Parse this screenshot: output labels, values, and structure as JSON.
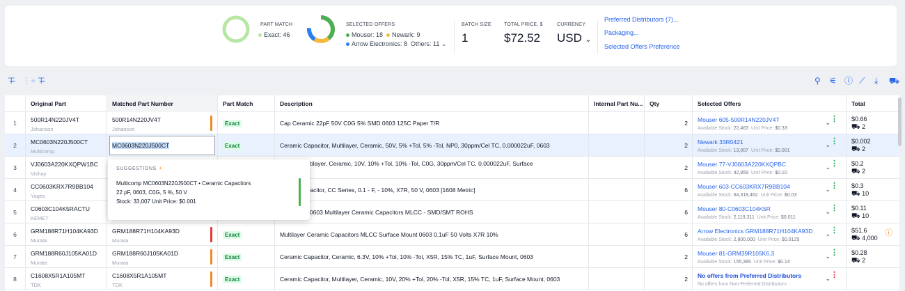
{
  "summary": {
    "part_match": {
      "label": "PART MATCH",
      "exact": "Exact: 46",
      "exact_color": "#4caf50"
    },
    "selected_offers": {
      "label": "SELECTED OFFERS",
      "mouser": "Mouser: 18",
      "newark": "Newark: 9",
      "arrow": "Arrow Electronics: 8",
      "others": "Others: 11",
      "colors": {
        "mouser": "#4caf50",
        "newark": "#f5b83d",
        "arrow": "#2b7ef0",
        "others": "#b06ce0"
      }
    },
    "batch_size": {
      "label": "BATCH SIZE",
      "value": "1"
    },
    "total_price": {
      "label": "TOTAL PRICE, $",
      "value": "$72.52"
    },
    "currency": {
      "label": "CURRENCY",
      "value": "USD"
    },
    "links": {
      "preferred": "Preferred Distributors (7)...",
      "packaging": "Packaging...",
      "offers_pref": "Selected Offers Preference"
    }
  },
  "toolbar": {
    "left_icons": [
      "add-row-icon",
      "insert-column-icon",
      "add-above-icon"
    ],
    "right_icons": [
      "search-icon",
      "filter-icon",
      "info-icon",
      "chart-icon",
      "download-icon",
      "cart-icon"
    ]
  },
  "table": {
    "columns": [
      "Original Part",
      "Matched Part Number",
      "Part Match",
      "Description",
      "Internal Part Nu...",
      "Qty",
      "Selected Offers",
      "Total"
    ],
    "rows": [
      {
        "n": "1",
        "orig": "500R14N220JV4T",
        "orig_mfr": "Johanson",
        "matched": "500R14N220JV4T",
        "matched_mfr": "Johanson",
        "bar": "#f08a24",
        "match": "Exact",
        "desc": "Cap Ceramic 22pF 50V C0G 5% SMD 0603 125C Paper T/R",
        "qty": "2",
        "offer": "Mouser 605-500R14N220JV4T",
        "stock": "22,463",
        "price": "$0.33",
        "total": "$0.66",
        "cart": "2",
        "kebab": "#16a34a"
      },
      {
        "n": "2",
        "orig": "MC0603N220J500CT",
        "orig_mfr": "Multicomp",
        "matched": "MC0603N220J500CT",
        "matched_mfr": "",
        "bar": "",
        "match": "Exact",
        "desc": "Ceramic Capacitor, Multilayer, Ceramic, 50V, 5% +Tol, 5% -Tol, NP0, 30ppm/Cel TC, 0.000022uF, 0603",
        "qty": "2",
        "offer": "Newark 33R0421",
        "stock": "13,007",
        "price": "$0.001",
        "total": "$0.002",
        "cart": "2",
        "kebab": "#16a34a"
      },
      {
        "n": "3",
        "orig": "VJ0603A220KXQPW1BC",
        "orig_mfr": "Vishay",
        "matched": "",
        "matched_mfr": "",
        "bar": "",
        "match": "",
        "desc": "pacitor, Multilayer, Ceramic, 10V, 10% +Tol, 10% -Tol, C0G, 30ppm/Cel TC, 0.000022uF, Surface",
        "desc2": "3",
        "qty": "2",
        "offer": "Mouser 77-VJ0603A220KXQPBC",
        "stock": "42,959",
        "price": "$0.10",
        "total": "$0.2",
        "cart": "2",
        "kebab": "#16a34a"
      },
      {
        "n": "4",
        "orig": "CC0603KRX7R9BB104",
        "orig_mfr": "Yageo",
        "matched": "",
        "matched_mfr": "",
        "bar": "",
        "match": "",
        "desc": "eramic Capacitor, CC Series, 0.1 - F, - 10%, X7R, 50 V, 0603 [1608 Metric]",
        "qty": "6",
        "offer": "Mouser 603-CC603KRX7R9BB104",
        "stock": "64,318,462",
        "price": "$0.03",
        "total": "$0.3",
        "cart": "10",
        "kebab": "#16a34a"
      },
      {
        "n": "5",
        "orig": "C0603C104K5RACTU",
        "orig_mfr": "KEMET",
        "matched": "",
        "matched_mfr": "",
        "bar": "",
        "match": "",
        "desc": "X7R ±10% 0603 Multilayer Ceramic Capacitors MLCC - SMD/SMT ROHS",
        "qty": "6",
        "offer": "Mouser 80-C0603C104K5R",
        "stock": "2,119,311",
        "price": "$0.011",
        "total": "$0.11",
        "cart": "10",
        "kebab": "#16a34a"
      },
      {
        "n": "6",
        "orig": "GRM188R71H104KA93D",
        "orig_mfr": "Murata",
        "matched": "GRM188R71H104KA93D",
        "matched_mfr": "Murata",
        "bar": "#e53935",
        "match": "Exact",
        "desc": "Multilayer Ceramic Capacitors MLCC Surface Mount 0603 0.1uF 50 Volts X7R 10%",
        "qty": "6",
        "offer": "Arrow Electronics GRM188R71H104KA93D",
        "stock": "2,800,000",
        "price": "$0.0129",
        "total": "$51.6",
        "cart": "4,000",
        "kebab": "#16a34a",
        "warn": true
      },
      {
        "n": "7",
        "orig": "GRM188R60J105KA01D",
        "orig_mfr": "Murata",
        "matched": "GRM188R60J105KA01D",
        "matched_mfr": "Murata",
        "bar": "#f08a24",
        "match": "Exact",
        "desc": "Ceramic Capacitor, Ceramic, 6.3V, 10% +Tol, 10% -Tol, X5R, 15% TC, 1uF, Surface Mount, 0603",
        "qty": "2",
        "offer": "Mouser 81-GRM39R105K6.3",
        "stock": "155,385",
        "price": "$0.14",
        "total": "$0.28",
        "cart": "2",
        "kebab": "#16a34a"
      },
      {
        "n": "8",
        "orig": "C1608X5R1A105MT",
        "orig_mfr": "TDK",
        "matched": "C1608X5R1A105MT",
        "matched_mfr": "TDK",
        "bar": "#f08a24",
        "match": "Exact",
        "desc": "Ceramic Capacitor, Multilayer, Ceramic, 10V, 20% +Tol, 20% -Tol, X5R, 15% TC, 1uF, Surface Mount, 0603",
        "qty": "2",
        "no_offer": "No offers from Preferred Distributors",
        "no_offer_sub": "No offers from Non-Preferred Distributors",
        "kebab": "#dc2626"
      }
    ],
    "stock_label": "Available Stock:",
    "price_label": "Unit Price:"
  },
  "popup": {
    "title": "SUGGESTIONS",
    "line1": "Multicomp  MC0603N220J500CT  •  Ceramic Capacitors",
    "line2": "22 pF, 0603, C0G, 5 %, 50 V",
    "line3": "Stock: 33,007    Unit Price: $0.001"
  }
}
